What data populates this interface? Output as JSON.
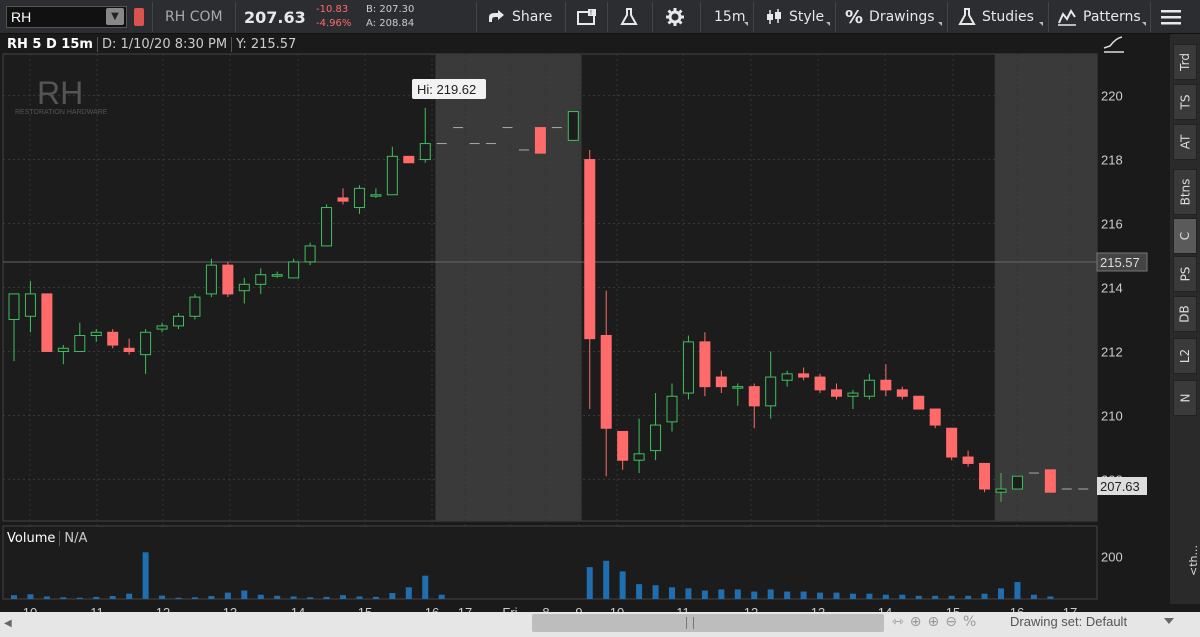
{
  "toolbar": {
    "symbol": "RH",
    "description": "RH COM",
    "last": "207.63",
    "change": "-10.83",
    "change_pct": "-4.96%",
    "bid": "B: 207.30",
    "ask": "A: 208.84",
    "share_label": "Share",
    "interval_label": "15m",
    "style_label": "Style",
    "drawings_label": "Drawings",
    "studies_label": "Studies",
    "patterns_label": "Patterns",
    "down_color": "#ff6b6b",
    "up_color": "#3fbf5f"
  },
  "chart_header": {
    "title": "RH 5 D 15m",
    "date": "D: 1/10/20 8:30 PM",
    "y": "Y: 215.57"
  },
  "logo": {
    "mark": "RH",
    "name": "RESTORATION HARDWARE"
  },
  "volume_header": {
    "label": "Volume",
    "value": "N/A"
  },
  "right_tabs": [
    "Trd",
    "TS",
    "AT",
    "Btns",
    "C",
    "PS",
    "DB",
    "L2",
    "N"
  ],
  "bottom_bar": {
    "drawing_set": "Drawing set: Default",
    "side_label": "<th..."
  },
  "chart_data": {
    "type": "candlestick",
    "price_axis": {
      "ticks": [
        208,
        210,
        212,
        214,
        216,
        218,
        220
      ],
      "range": [
        206.7,
        221.3
      ]
    },
    "volume_axis": {
      "ticks": [
        200
      ],
      "range": [
        0,
        245
      ]
    },
    "x_tick_labels": [
      "10",
      "11",
      "12",
      "13",
      "14",
      "15",
      "16",
      "17",
      "Fri",
      "8",
      "9",
      "10",
      "11",
      "12",
      "13",
      "14",
      "15",
      "16",
      "17"
    ],
    "crosshair_value": "215.57",
    "last_value": "207.63",
    "hi_annotation": "Hi: 219.62",
    "colors": {
      "up": "#3fbf5f",
      "down": "#ff6b6b",
      "volume": "#1f6fb0",
      "shade": "#3a3a3a"
    },
    "candles": [
      {
        "o": 213.0,
        "h": 213.2,
        "l": 211.7,
        "c": 213.8
      },
      {
        "o": 213.1,
        "h": 214.2,
        "l": 212.6,
        "c": 213.8
      },
      {
        "o": 213.8,
        "h": 213.8,
        "l": 212.0,
        "c": 212.0
      },
      {
        "o": 212.0,
        "h": 212.2,
        "l": 211.6,
        "c": 212.1
      },
      {
        "o": 212.0,
        "h": 212.9,
        "l": 212.0,
        "c": 212.5
      },
      {
        "o": 212.5,
        "h": 212.7,
        "l": 212.3,
        "c": 212.6
      },
      {
        "o": 212.6,
        "h": 212.7,
        "l": 212.1,
        "c": 212.2
      },
      {
        "o": 212.1,
        "h": 212.4,
        "l": 211.9,
        "c": 212.0
      },
      {
        "o": 211.9,
        "h": 212.7,
        "l": 211.3,
        "c": 212.6
      },
      {
        "o": 212.7,
        "h": 212.9,
        "l": 212.6,
        "c": 212.8
      },
      {
        "o": 212.8,
        "h": 213.2,
        "l": 212.7,
        "c": 213.1
      },
      {
        "o": 213.1,
        "h": 213.8,
        "l": 213.0,
        "c": 213.7
      },
      {
        "o": 213.8,
        "h": 214.9,
        "l": 213.7,
        "c": 214.7
      },
      {
        "o": 214.7,
        "h": 214.8,
        "l": 213.7,
        "c": 213.8
      },
      {
        "o": 213.9,
        "h": 214.3,
        "l": 213.5,
        "c": 214.1
      },
      {
        "o": 214.1,
        "h": 214.6,
        "l": 213.8,
        "c": 214.4
      },
      {
        "o": 214.4,
        "h": 214.5,
        "l": 214.3,
        "c": 214.4
      },
      {
        "o": 214.3,
        "h": 214.9,
        "l": 214.3,
        "c": 214.8
      },
      {
        "o": 214.8,
        "h": 215.4,
        "l": 214.7,
        "c": 215.3
      },
      {
        "o": 215.3,
        "h": 216.6,
        "l": 215.3,
        "c": 216.5
      },
      {
        "o": 216.8,
        "h": 217.1,
        "l": 216.6,
        "c": 216.7
      },
      {
        "o": 216.5,
        "h": 217.2,
        "l": 216.3,
        "c": 217.1
      },
      {
        "o": 216.9,
        "h": 217.1,
        "l": 216.8,
        "c": 216.9
      },
      {
        "o": 216.9,
        "h": 218.4,
        "l": 216.9,
        "c": 218.1
      },
      {
        "o": 218.1,
        "h": 218.1,
        "l": 217.9,
        "c": 217.9
      },
      {
        "o": 218.0,
        "h": 219.62,
        "l": 217.9,
        "c": 218.5
      },
      {
        "o": 218.5,
        "h": 218.5,
        "l": 218.5,
        "c": 218.5
      },
      {
        "o": 219.0,
        "h": 219.0,
        "l": 219.0,
        "c": 219.0
      },
      {
        "o": 218.5,
        "h": 218.5,
        "l": 218.5,
        "c": 218.5
      },
      {
        "o": 218.5,
        "h": 218.5,
        "l": 218.5,
        "c": 218.5
      },
      {
        "o": 219.0,
        "h": 219.0,
        "l": 219.0,
        "c": 219.0
      },
      {
        "o": 218.3,
        "h": 218.3,
        "l": 218.3,
        "c": 218.3
      },
      {
        "o": 219.0,
        "h": 219.0,
        "l": 219.0,
        "c": 218.2
      },
      {
        "o": 219.0,
        "h": 219.0,
        "l": 219.0,
        "c": 219.0
      },
      {
        "o": 218.6,
        "h": 219.5,
        "l": 218.6,
        "c": 219.5
      },
      {
        "o": 218.0,
        "h": 218.3,
        "l": 210.2,
        "c": 212.4
      },
      {
        "o": 212.5,
        "h": 213.9,
        "l": 208.1,
        "c": 209.6
      },
      {
        "o": 209.5,
        "h": 209.5,
        "l": 208.3,
        "c": 208.6
      },
      {
        "o": 208.6,
        "h": 209.9,
        "l": 208.2,
        "c": 208.8
      },
      {
        "o": 208.9,
        "h": 210.7,
        "l": 208.6,
        "c": 209.7
      },
      {
        "o": 209.8,
        "h": 211.0,
        "l": 209.5,
        "c": 210.6
      },
      {
        "o": 210.7,
        "h": 212.5,
        "l": 210.5,
        "c": 212.3
      },
      {
        "o": 212.3,
        "h": 212.6,
        "l": 210.6,
        "c": 210.9
      },
      {
        "o": 211.2,
        "h": 211.4,
        "l": 210.7,
        "c": 210.9
      },
      {
        "o": 210.9,
        "h": 211.0,
        "l": 210.3,
        "c": 210.9
      },
      {
        "o": 210.9,
        "h": 211.0,
        "l": 209.6,
        "c": 210.3
      },
      {
        "o": 210.3,
        "h": 212.0,
        "l": 209.9,
        "c": 211.2
      },
      {
        "o": 211.1,
        "h": 211.4,
        "l": 210.9,
        "c": 211.3
      },
      {
        "o": 211.3,
        "h": 211.5,
        "l": 211.1,
        "c": 211.2
      },
      {
        "o": 211.2,
        "h": 211.3,
        "l": 210.7,
        "c": 210.8
      },
      {
        "o": 210.8,
        "h": 211.0,
        "l": 210.5,
        "c": 210.6
      },
      {
        "o": 210.6,
        "h": 210.8,
        "l": 210.2,
        "c": 210.7
      },
      {
        "o": 210.6,
        "h": 211.3,
        "l": 210.5,
        "c": 211.1
      },
      {
        "o": 211.1,
        "h": 211.6,
        "l": 210.6,
        "c": 210.8
      },
      {
        "o": 210.8,
        "h": 210.9,
        "l": 210.5,
        "c": 210.6
      },
      {
        "o": 210.6,
        "h": 210.6,
        "l": 210.2,
        "c": 210.2
      },
      {
        "o": 210.2,
        "h": 210.2,
        "l": 209.6,
        "c": 209.7
      },
      {
        "o": 209.6,
        "h": 209.6,
        "l": 208.6,
        "c": 208.7
      },
      {
        "o": 208.7,
        "h": 208.9,
        "l": 208.4,
        "c": 208.5
      },
      {
        "o": 208.5,
        "h": 208.5,
        "l": 207.6,
        "c": 207.7
      },
      {
        "o": 207.6,
        "h": 208.2,
        "l": 207.3,
        "c": 207.7
      },
      {
        "o": 207.7,
        "h": 208.1,
        "l": 207.7,
        "c": 208.1
      },
      {
        "o": 208.2,
        "h": 208.2,
        "l": 208.2,
        "c": 208.2
      },
      {
        "o": 208.3,
        "h": 208.3,
        "l": 207.6,
        "c": 207.6
      },
      {
        "o": 207.7,
        "h": 207.7,
        "l": 207.7,
        "c": 207.7
      },
      {
        "o": 207.7,
        "h": 207.7,
        "l": 207.7,
        "c": 207.7
      }
    ],
    "volumes": [
      18,
      22,
      12,
      8,
      6,
      10,
      14,
      25,
      220,
      16,
      6,
      8,
      14,
      30,
      40,
      20,
      15,
      12,
      8,
      10,
      18,
      12,
      10,
      28,
      55,
      110,
      20,
      0,
      0,
      0,
      0,
      0,
      0,
      0,
      0,
      150,
      180,
      130,
      70,
      65,
      55,
      50,
      40,
      45,
      45,
      35,
      45,
      35,
      35,
      30,
      30,
      25,
      25,
      20,
      20,
      15,
      15,
      15,
      15,
      25,
      50,
      80,
      20,
      12,
      0,
      0
    ],
    "session_shade": [
      {
        "from": 26,
        "to": 34
      },
      {
        "from": 60,
        "to": 66
      }
    ]
  }
}
